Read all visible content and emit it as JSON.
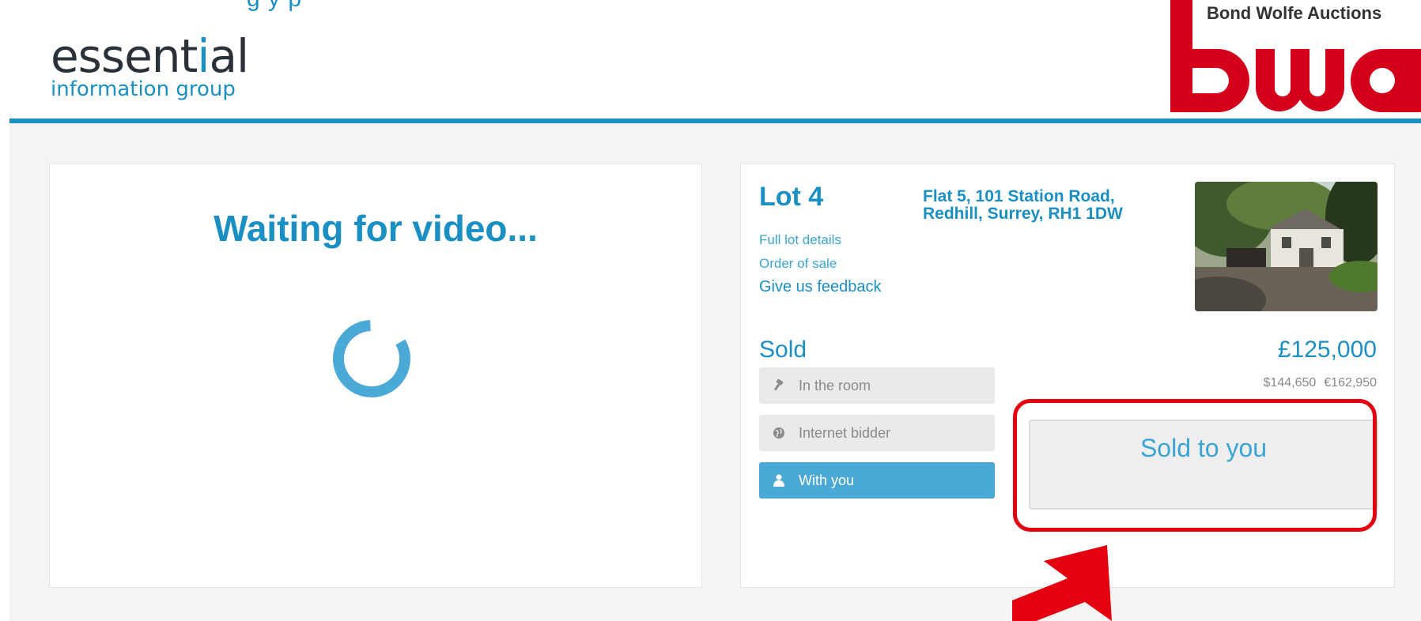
{
  "header": {
    "top_text": "g y                p",
    "eig_logo": {
      "word_prefix": "essent",
      "word_i": "i",
      "word_suffix": "al",
      "sub": "information group"
    },
    "bwa": {
      "title": "Bond Wolfe Auctions"
    }
  },
  "video": {
    "message": "Waiting for video..."
  },
  "lot": {
    "title": "Lot 4",
    "links": [
      "Full lot details",
      "Order of sale",
      "Give us feedback"
    ],
    "address_line1": "Flat 5, 101 Station Road,",
    "address_line2": "Redhill, Surrey, RH1 1DW",
    "status": "Sold",
    "price": "£125,000",
    "price_usd": "$144,650",
    "price_eur": "€162,950",
    "bidder_options": [
      {
        "label": "In the room",
        "icon": "gavel-icon",
        "active": false
      },
      {
        "label": "Internet bidder",
        "icon": "globe-icon",
        "active": false
      },
      {
        "label": "With you",
        "icon": "user-icon",
        "active": true
      }
    ],
    "sold_message": "Sold to you"
  },
  "colors": {
    "brand_blue": "#1a8fc4",
    "button_active": "#4aa9d6",
    "bwa_red": "#d4001a",
    "highlight_red": "#e4000f"
  }
}
